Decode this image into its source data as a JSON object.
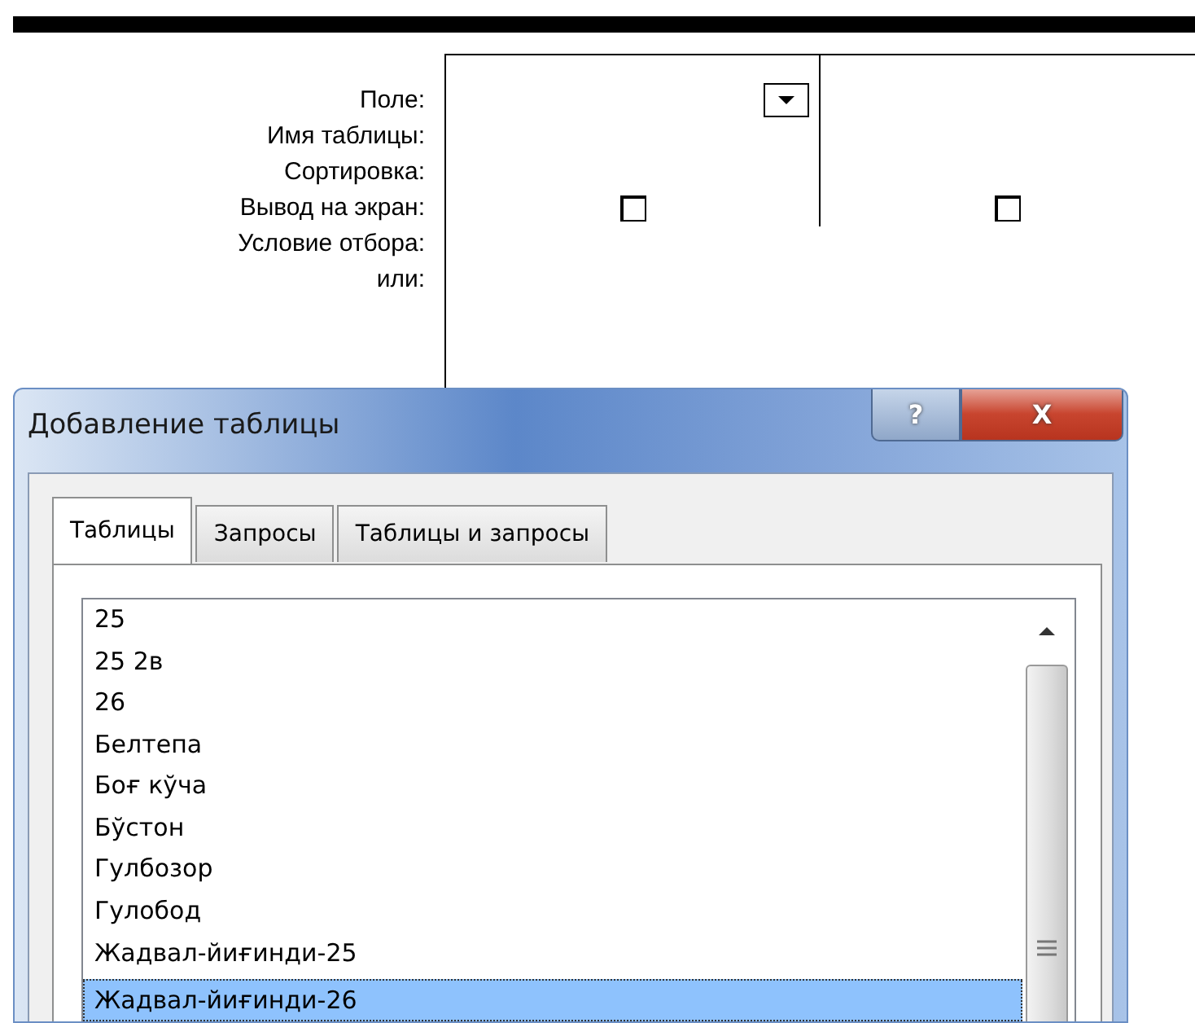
{
  "query_grid": {
    "row_labels": [
      "Поле:",
      "Имя таблицы:",
      "Сортировка:",
      "Вывод на экран:",
      "Условие отбора:",
      "или:"
    ],
    "columns": [
      {
        "has_dropdown": true,
        "show_checked": false
      },
      {
        "has_dropdown": false,
        "show_checked": false
      }
    ]
  },
  "dialog": {
    "title": "Добавление таблицы",
    "title_buttons": [
      {
        "kind": "help",
        "label": "?"
      },
      {
        "kind": "close",
        "label": "X"
      }
    ],
    "tabs": [
      {
        "label": "Таблицы",
        "selected": true
      },
      {
        "label": "Запросы",
        "selected": false
      },
      {
        "label": "Таблицы и запросы",
        "selected": false
      }
    ],
    "list_items": [
      {
        "label": "25",
        "selected": false
      },
      {
        "label": "25 2в",
        "selected": false
      },
      {
        "label": "26",
        "selected": false
      },
      {
        "label": "Белтепа",
        "selected": false
      },
      {
        "label": "Боғ кўча",
        "selected": false
      },
      {
        "label": "Бўстон",
        "selected": false
      },
      {
        "label": "Гулбозор",
        "selected": false
      },
      {
        "label": "Гулобод",
        "selected": false
      },
      {
        "label": "Жадвал-йиғинди-25",
        "selected": false
      },
      {
        "label": "Жадвал-йиғинди-26",
        "selected": true
      }
    ]
  }
}
